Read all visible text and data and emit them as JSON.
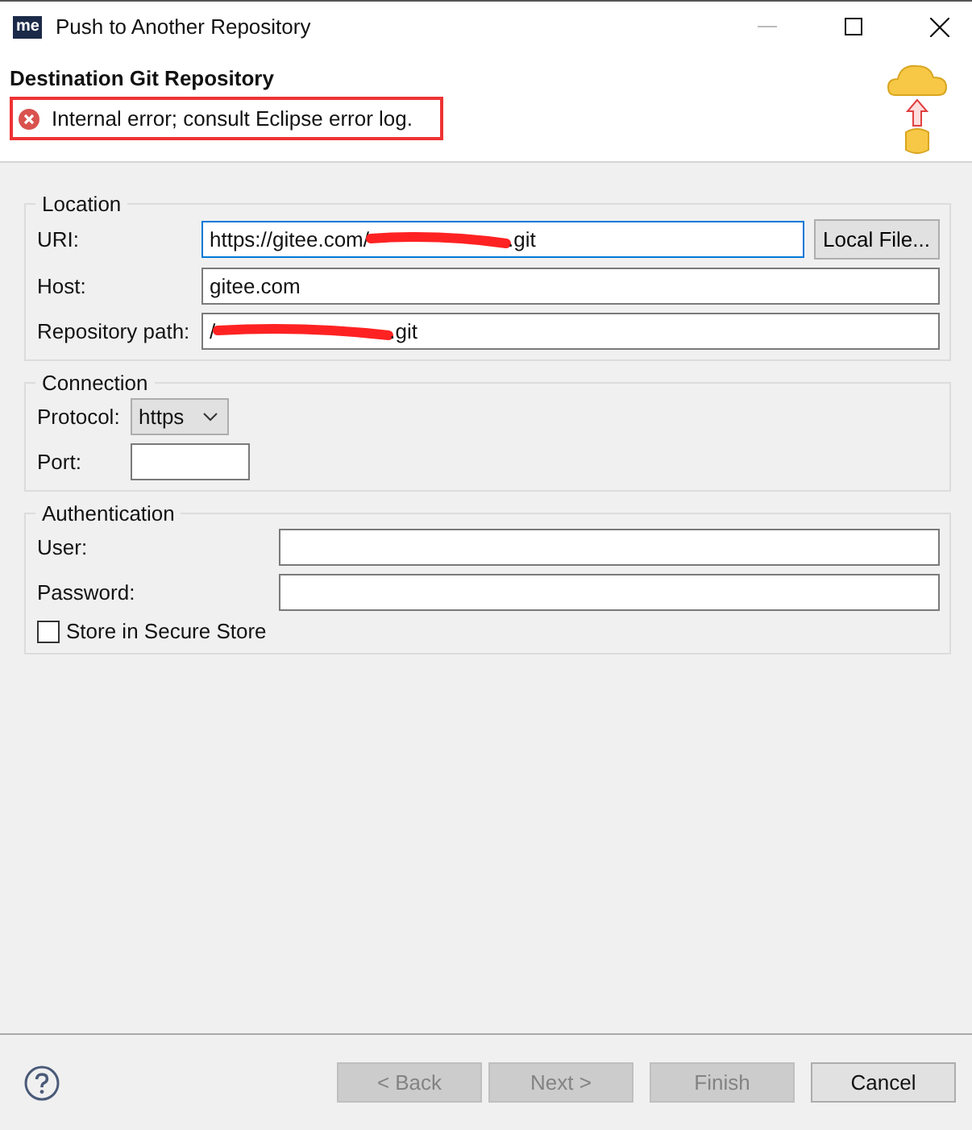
{
  "window": {
    "title": "Push to Another Repository",
    "app_badge": "me"
  },
  "header": {
    "title": "Destination Git Repository",
    "message": "Internal error; consult Eclipse error log."
  },
  "location": {
    "legend": "Location",
    "uri": {
      "label": "URI:",
      "value_start": "https://gitee.com/",
      "value_end": ".git",
      "button": "Local File..."
    },
    "host": {
      "label": "Host:",
      "value": "gitee.com"
    },
    "path": {
      "label": "Repository path:",
      "value_start": "/",
      "value_end": ".git"
    }
  },
  "connection": {
    "legend": "Connection",
    "protocol": {
      "label": "Protocol:",
      "value": "https"
    },
    "port": {
      "label": "Port:"
    }
  },
  "authentication": {
    "legend": "Authentication",
    "user": {
      "label": "User:"
    },
    "password": {
      "label": "Password:"
    },
    "store": {
      "label": "Store in Secure Store",
      "checked": false
    }
  },
  "buttons": [
    {
      "label": "< Back",
      "disabled": true
    },
    {
      "label": "Next >",
      "disabled": true
    },
    {
      "label": "Finish",
      "disabled": true
    },
    {
      "label": "Cancel",
      "disabled": false
    }
  ]
}
